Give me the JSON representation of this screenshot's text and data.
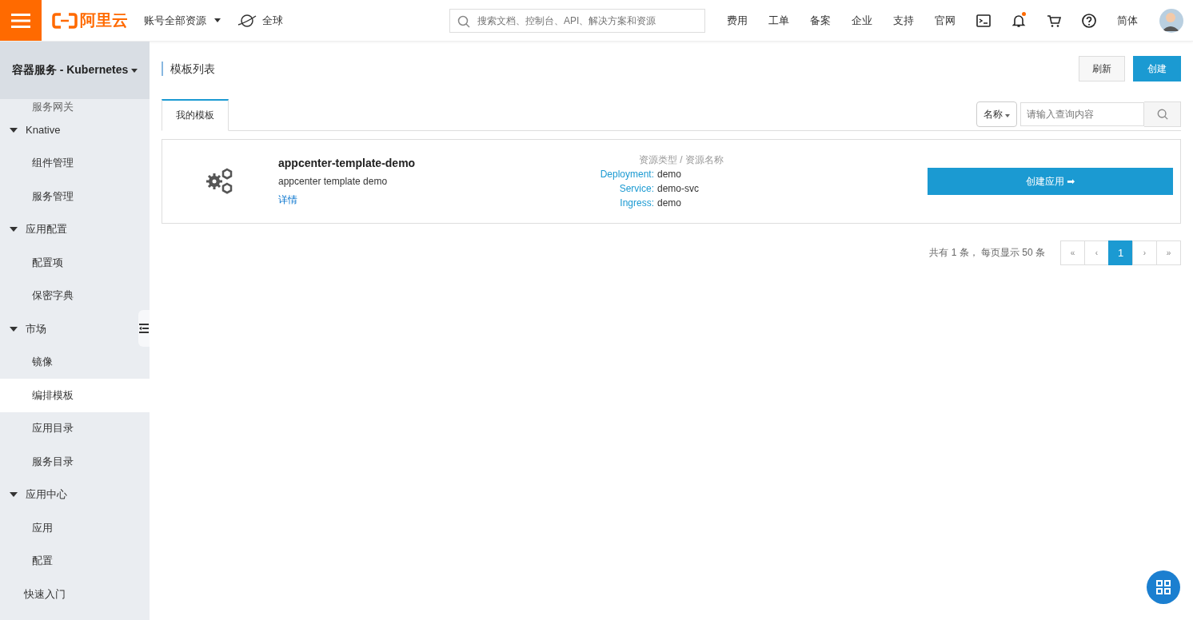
{
  "topbar": {
    "logo": "阿里云",
    "account_menu": "账号全部资源",
    "region": "全球",
    "search": {
      "placeholder": "搜索文档、控制台、API、解决方案和资源"
    },
    "links": [
      "费用",
      "工单",
      "备案",
      "企业",
      "支持",
      "官网"
    ],
    "notification_dot": true,
    "language": "简体"
  },
  "sidebar": {
    "product": "容器服务 - Kubernetes",
    "items": [
      {
        "label": "服务网关",
        "selected": false
      },
      {
        "label": "Knative",
        "expanded": true,
        "children": [
          {
            "label": "组件管理",
            "selected": false
          },
          {
            "label": "服务管理",
            "selected": false
          }
        ]
      },
      {
        "label": "应用配置",
        "expanded": true,
        "children": [
          {
            "label": "配置项",
            "selected": false
          },
          {
            "label": "保密字典",
            "selected": false
          }
        ]
      },
      {
        "label": "市场",
        "expanded": true,
        "children": [
          {
            "label": "镜像",
            "selected": false
          },
          {
            "label": "编排模板",
            "selected": true
          },
          {
            "label": "应用目录",
            "selected": false
          },
          {
            "label": "服务目录",
            "selected": false
          }
        ]
      },
      {
        "label": "应用中心",
        "expanded": true,
        "children": [
          {
            "label": "应用",
            "selected": false
          },
          {
            "label": "配置",
            "selected": false
          }
        ]
      },
      {
        "label": "快速入门",
        "selected": false
      }
    ]
  },
  "page": {
    "title": "模板列表",
    "buttons": [
      {
        "label": "刷新",
        "kind": "default"
      },
      {
        "label": "创建",
        "kind": "primary"
      }
    ],
    "tabs": [
      {
        "label": "我的模板",
        "selected": true
      }
    ],
    "filter": {
      "field": "名称",
      "placeholder": "请输入查询内容"
    },
    "templates": [
      {
        "name": "appcenter-template-demo",
        "description": "appcenter template demo",
        "link": "详情",
        "resource_header": "资源类型 /  资源名称",
        "resources": [
          {
            "type": "Deployment:",
            "name": "demo"
          },
          {
            "type": "Service:",
            "name": "demo-svc"
          },
          {
            "type": "Ingress:",
            "name": "demo"
          }
        ],
        "action": "创建应用 ➡"
      }
    ],
    "pagination": {
      "summary": "共有 1 条， 每页显示 50 条",
      "pages": [
        {
          "label": "«",
          "selected": false
        },
        {
          "label": "‹",
          "selected": false
        },
        {
          "label": "1",
          "selected": true
        },
        {
          "label": "›",
          "selected": false
        },
        {
          "label": "»",
          "selected": false
        }
      ]
    }
  }
}
